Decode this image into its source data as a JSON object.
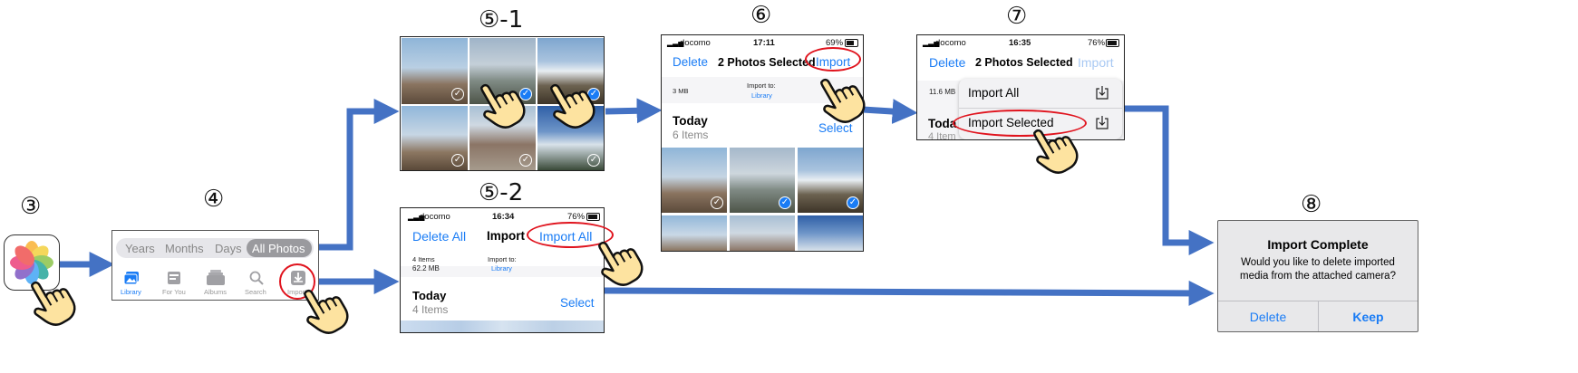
{
  "steps": {
    "s3": "③",
    "s4": "④",
    "s5_1": "⑤-1",
    "s5_2": "⑤-2",
    "s6": "⑥",
    "s7": "⑦",
    "s8": "⑧"
  },
  "icons": {
    "photos_app": "photos-app-icon",
    "hand": "pointing-hand-icon",
    "library": "photo-library-icon",
    "for_you": "for-you-icon",
    "albums": "albums-icon",
    "search": "search-icon",
    "import": "import-icon",
    "check": "check-circle-icon",
    "battery": "battery-icon",
    "wifi": "wifi-icon",
    "signal": "signal-icon"
  },
  "colors": {
    "accent": "#1a7cf5",
    "arrow": "#4472c4",
    "highlight": "#e0141e"
  },
  "tabs_panel": {
    "segments": [
      "Years",
      "Months",
      "Days",
      "All Photos"
    ],
    "tabbar": [
      "Library",
      "For You",
      "Albums",
      "Search",
      "Import"
    ]
  },
  "screen5_2": {
    "carrier": "docomo",
    "time": "16:34",
    "battery": "76%",
    "delete_all": "Delete All",
    "title": "Import",
    "import_all": "Import All",
    "items": "4 Items",
    "size": "62.2 MB",
    "import_to": "Import to:",
    "library": "Library",
    "section": "Today",
    "section_count": "4 Items",
    "select": "Select"
  },
  "screen6": {
    "carrier": "docomo",
    "time": "17:11",
    "battery": "69%",
    "delete": "Delete",
    "title": "2 Photos Selected",
    "import": "Import",
    "size": "3 MB",
    "import_to": "Import to:",
    "library": "Library",
    "section": "Today",
    "section_count": "6 Items",
    "select": "Select"
  },
  "screen7": {
    "carrier": "docomo",
    "time": "16:35",
    "battery": "76%",
    "delete": "Delete",
    "title": "2 Photos Selected",
    "import": "Import",
    "size": "11.6 MB",
    "section_partial": "Toda",
    "count_partial": "4 Item",
    "menu_import_all": "Import All",
    "menu_import_selected": "Import Selected"
  },
  "dialog8": {
    "title": "Import Complete",
    "message_line1": "Would you like to delete imported",
    "message_line2": "media from the attached camera?",
    "delete": "Delete",
    "keep": "Keep"
  }
}
